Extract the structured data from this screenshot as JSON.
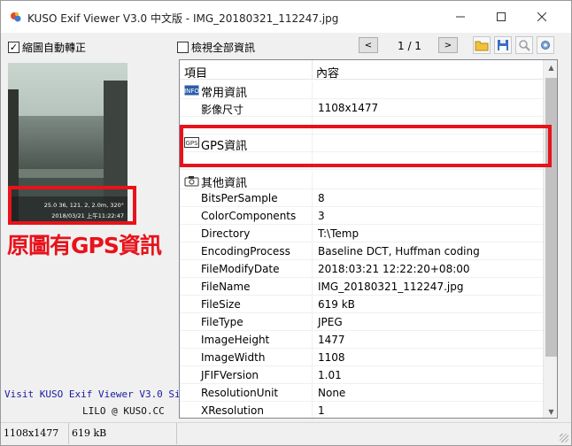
{
  "window": {
    "title": "KUSO Exif Viewer V3.0 中文版 - IMG_20180321_112247.jpg",
    "minimize_icon": "minimize-icon",
    "maximize_icon": "maximize-icon",
    "close_icon": "close-icon"
  },
  "toolbar": {
    "auto_rotate_label": "縮圖自動轉正",
    "auto_rotate_checked": true,
    "show_all_label": "檢視全部資訊",
    "show_all_checked": false,
    "prev_label": "<",
    "page_indicator": "1 / 1",
    "next_label": ">",
    "icons": [
      "open-folder-icon",
      "save-icon",
      "zoom-icon",
      "settings-icon"
    ]
  },
  "preview": {
    "overlay_line1": "25.0   36, 121.      2, 2.0m, 320°",
    "overlay_line2": "2018/03/21 上午11:22:47"
  },
  "annotation": {
    "text": "原圖有GPS資訊",
    "color": "#e8121b"
  },
  "left_footer": {
    "site_link": "Visit KUSO Exif Viewer V3.0 Site",
    "credit": "LILO @ KUSO.CC"
  },
  "grid": {
    "header": {
      "col1": "項目",
      "col2": "內容"
    },
    "sections": [
      {
        "title": "常用資訊",
        "icon": "info-icon",
        "rows": [
          {
            "k": "影像尺寸",
            "v": "1108x1477"
          }
        ]
      },
      {
        "title": "GPS資訊",
        "icon": "gps-icon",
        "rows": []
      },
      {
        "title": "其他資訊",
        "icon": "camera-icon",
        "rows": [
          {
            "k": "BitsPerSample",
            "v": "8"
          },
          {
            "k": "ColorComponents",
            "v": "3"
          },
          {
            "k": "Directory",
            "v": "T:\\Temp"
          },
          {
            "k": "EncodingProcess",
            "v": "Baseline DCT, Huffman coding"
          },
          {
            "k": "FileModifyDate",
            "v": "2018:03:21 12:22:20+08:00"
          },
          {
            "k": "FileName",
            "v": "IMG_20180321_112247.jpg"
          },
          {
            "k": "FileSize",
            "v": "619 kB"
          },
          {
            "k": "FileType",
            "v": "JPEG"
          },
          {
            "k": "ImageHeight",
            "v": "1477"
          },
          {
            "k": "ImageWidth",
            "v": "1108"
          },
          {
            "k": "JFIFVersion",
            "v": "1.01"
          },
          {
            "k": "ResolutionUnit",
            "v": "None"
          },
          {
            "k": "XResolution",
            "v": "1"
          }
        ]
      }
    ]
  },
  "statusbar": {
    "dimensions": "1108x1477",
    "size": "619 kB"
  }
}
